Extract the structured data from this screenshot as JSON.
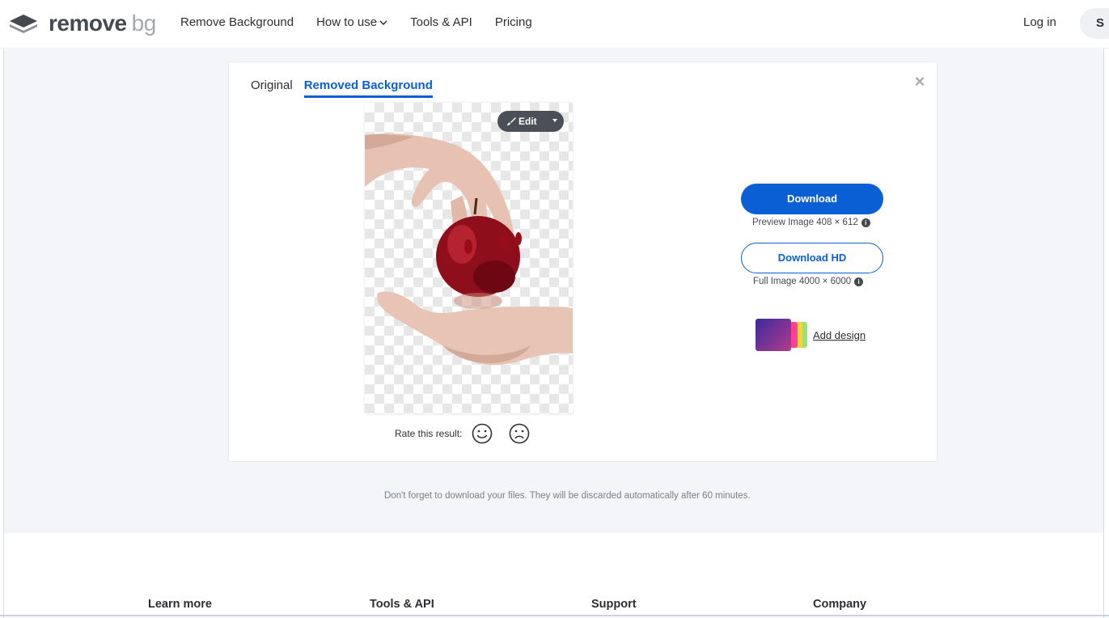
{
  "header": {
    "logo_word": "remove",
    "logo_bg": "bg",
    "nav": [
      {
        "label": "Remove Background"
      },
      {
        "label": "How to use"
      },
      {
        "label": "Tools & API"
      },
      {
        "label": "Pricing"
      }
    ],
    "login_label": "Log in",
    "signup_label": "S"
  },
  "card": {
    "tabs": [
      {
        "label": "Original",
        "active": false
      },
      {
        "label": "Removed Background",
        "active": true
      }
    ],
    "close_icon": "close-icon",
    "edit_label": "Edit",
    "rate_label": "Rate this result:",
    "download_label": "Download",
    "preview_meta": "Preview Image 408 × 612",
    "download_hd_label": "Download HD",
    "full_meta": "Full Image 4000 × 6000",
    "add_design_label": "Add design"
  },
  "notice": "Don't forget to download your files. They will be discarded automatically after 60 minutes.",
  "footer": {
    "columns": [
      "Learn more",
      "Tools & API",
      "Support",
      "Company"
    ]
  },
  "colors": {
    "accent": "#0b5fd4",
    "page_bg": "#f3f5f8",
    "text": "#2b2f33"
  }
}
